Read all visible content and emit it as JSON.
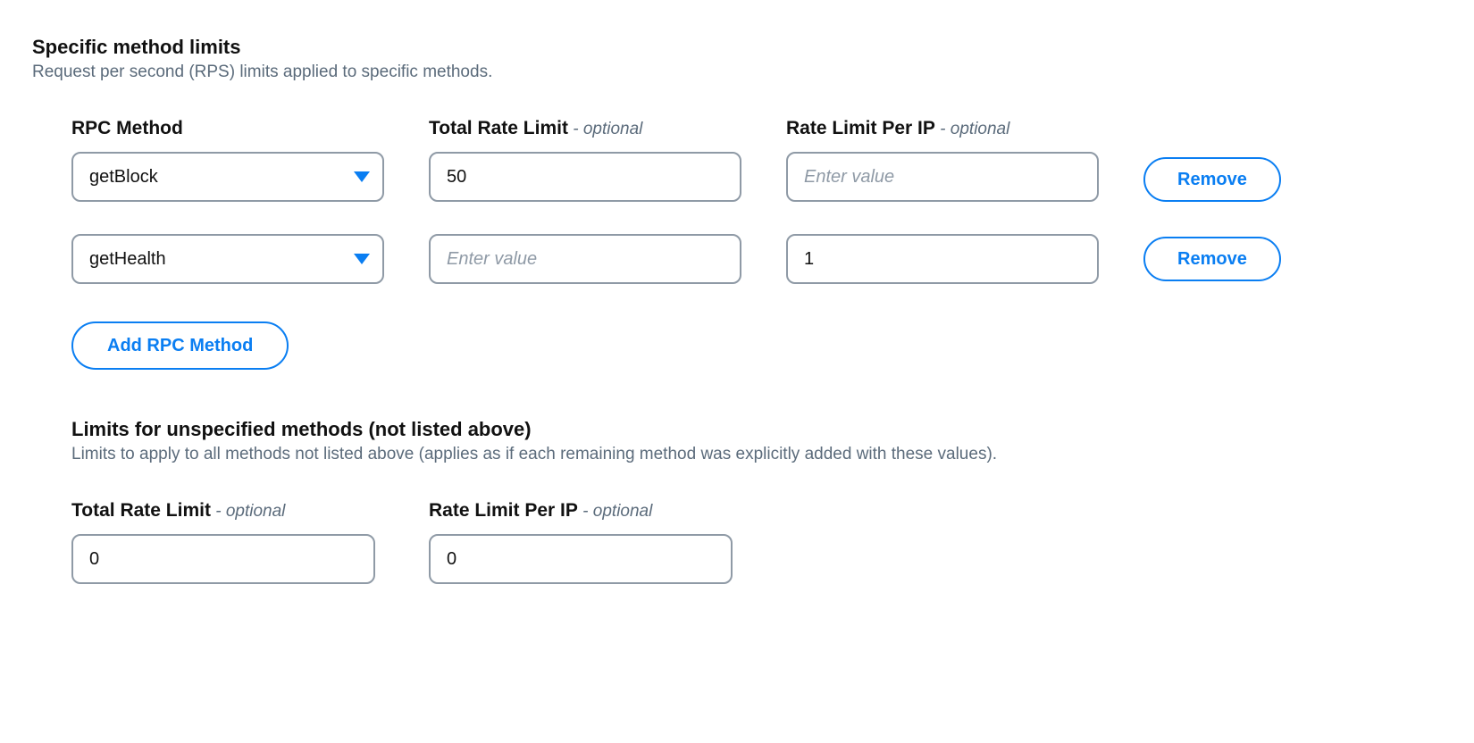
{
  "specific": {
    "title": "Specific method limits",
    "description": "Request per second (RPS) limits applied to specific methods.",
    "columns": {
      "rpc_method": "RPC Method",
      "total_rate_limit": "Total Rate Limit",
      "rate_limit_per_ip": "Rate Limit Per IP",
      "optional_suffix": " - optional"
    },
    "rows": [
      {
        "method": "getBlock",
        "total": "50",
        "per_ip": "",
        "placeholder": "Enter value"
      },
      {
        "method": "getHealth",
        "total": "",
        "per_ip": "1",
        "placeholder": "Enter value"
      }
    ],
    "remove_label": "Remove",
    "add_label": "Add RPC Method"
  },
  "unspecified": {
    "title": "Limits for unspecified methods (not listed above)",
    "description": "Limits to apply to all methods not listed above (applies as if each remaining method was explicitly added with these values).",
    "columns": {
      "total_rate_limit": "Total Rate Limit",
      "rate_limit_per_ip": "Rate Limit Per IP",
      "optional_suffix": " - optional"
    },
    "total_value": "0",
    "per_ip_value": "0"
  }
}
